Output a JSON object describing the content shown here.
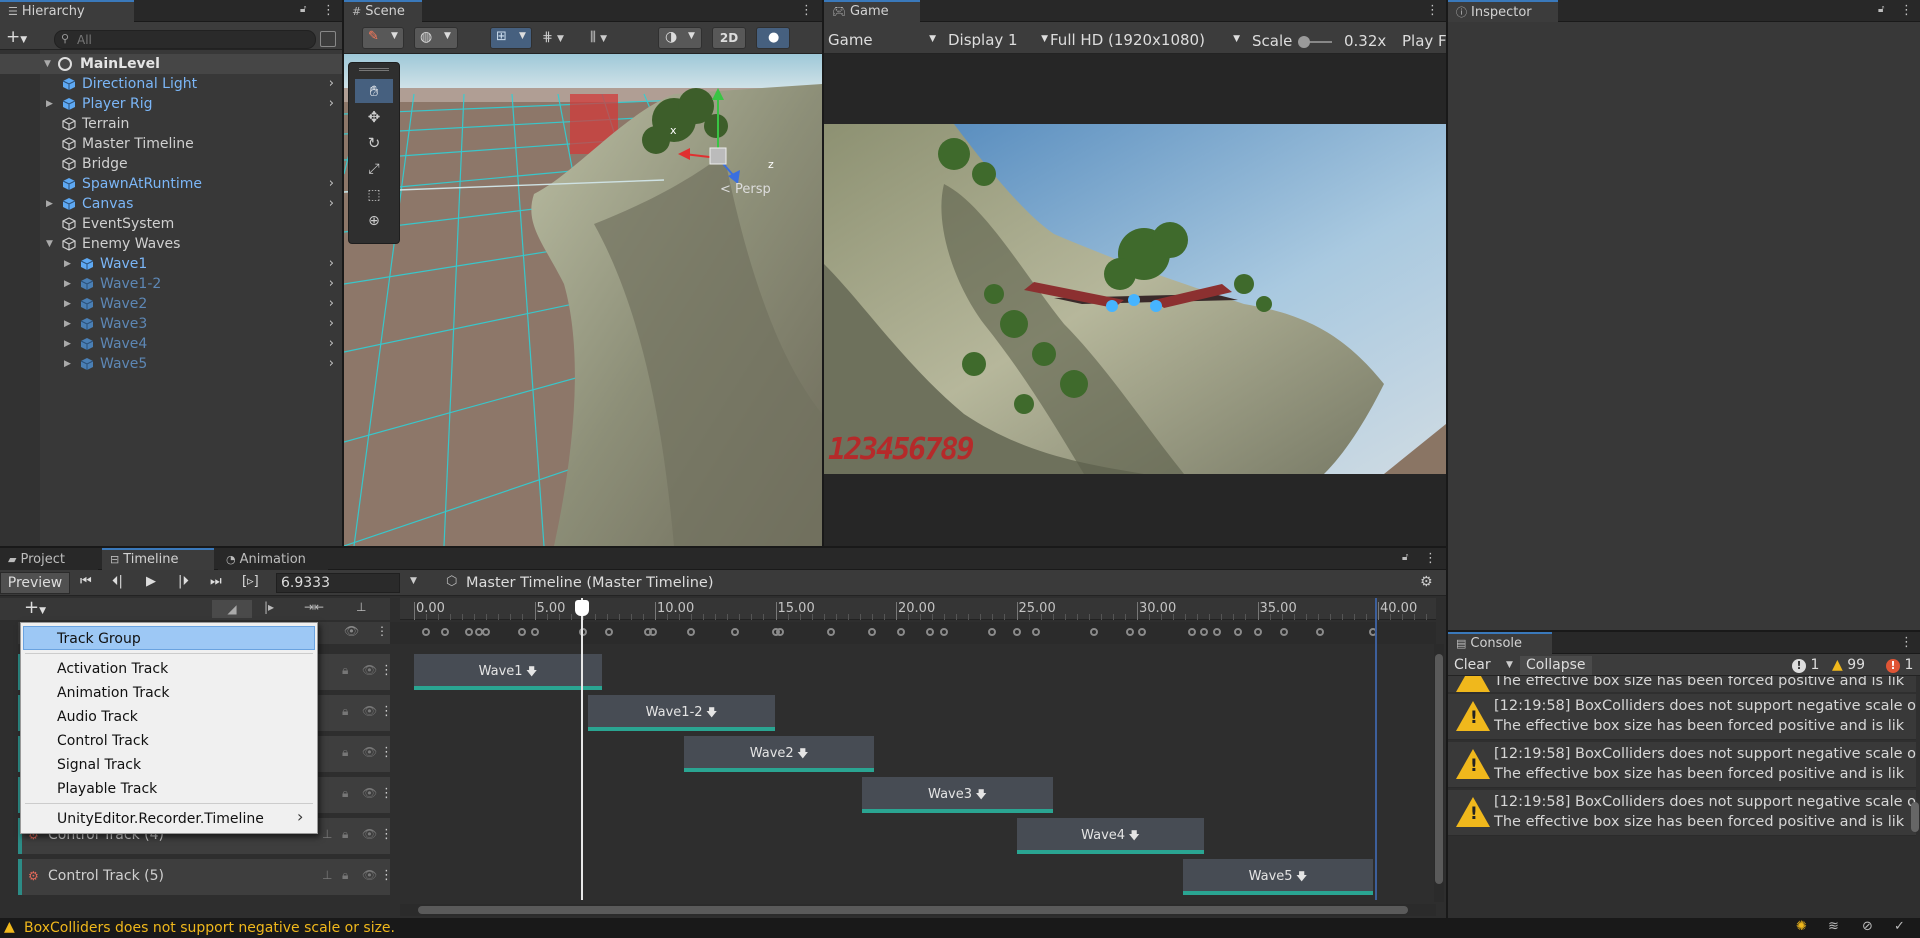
{
  "hierarchy": {
    "tab_label": "Hierarchy",
    "search_placeholder": "All",
    "scene_root": "MainLevel",
    "items": [
      {
        "label": "Directional Light",
        "kind": "prefab",
        "indent": 1,
        "expand": "",
        "chevron": true
      },
      {
        "label": "Player Rig",
        "kind": "prefab",
        "indent": 1,
        "expand": "▶",
        "chevron": true
      },
      {
        "label": "Terrain",
        "kind": "plain",
        "indent": 1,
        "expand": "",
        "chevron": false
      },
      {
        "label": "Master Timeline",
        "kind": "plain",
        "indent": 1,
        "expand": "",
        "chevron": false
      },
      {
        "label": "Bridge",
        "kind": "plain",
        "indent": 1,
        "expand": "",
        "chevron": false
      },
      {
        "label": "SpawnAtRuntime",
        "kind": "prefab",
        "indent": 1,
        "expand": "",
        "chevron": true
      },
      {
        "label": "Canvas",
        "kind": "prefab",
        "indent": 1,
        "expand": "▶",
        "chevron": true
      },
      {
        "label": "EventSystem",
        "kind": "plain",
        "indent": 1,
        "expand": "",
        "chevron": false
      },
      {
        "label": "Enemy Waves",
        "kind": "plain",
        "indent": 1,
        "expand": "▼",
        "chevron": false
      },
      {
        "label": "Wave1",
        "kind": "prefab",
        "indent": 2,
        "expand": "▶",
        "chevron": true
      },
      {
        "label": "Wave1-2",
        "kind": "prefab-dim",
        "indent": 2,
        "expand": "▶",
        "chevron": true
      },
      {
        "label": "Wave2",
        "kind": "prefab-dim",
        "indent": 2,
        "expand": "▶",
        "chevron": true
      },
      {
        "label": "Wave3",
        "kind": "prefab-dim",
        "indent": 2,
        "expand": "▶",
        "chevron": true
      },
      {
        "label": "Wave4",
        "kind": "prefab-dim",
        "indent": 2,
        "expand": "▶",
        "chevron": true
      },
      {
        "label": "Wave5",
        "kind": "prefab-dim",
        "indent": 2,
        "expand": "▶",
        "chevron": true
      }
    ]
  },
  "scene": {
    "tab_label": "Scene",
    "btn_2d": "2D",
    "persp_label": "< Persp",
    "gizmo_x": "x",
    "gizmo_z": "z"
  },
  "game": {
    "tab_label": "Game",
    "view_mode": "Game",
    "display": "Display 1",
    "resolution": "Full HD (1920x1080)",
    "scale_label": "Scale",
    "scale_value": "0.32x",
    "play_label": "Play F",
    "hud_digits": "123456789"
  },
  "inspector": {
    "tab_label": "Inspector"
  },
  "bottom_tabs": {
    "project": "Project",
    "timeline": "Timeline",
    "animation": "Animation"
  },
  "timeline": {
    "preview": "Preview",
    "frame_value": "6.9333",
    "asset_name": "Master Timeline (Master Timeline)",
    "ruler": [
      "0.00",
      "5.00",
      "10.00",
      "15.00",
      "20.00",
      "25.00",
      "30.00",
      "35.00",
      "40.00"
    ],
    "tracks": [
      "Control Track (4)",
      "Control Track (5)"
    ],
    "clips": [
      {
        "label": "Wave1",
        "start": 0.0,
        "end": 7.8
      },
      {
        "label": "Wave1-2",
        "start": 7.2,
        "end": 15.0
      },
      {
        "label": "Wave2",
        "start": 11.2,
        "end": 19.1
      },
      {
        "label": "Wave3",
        "start": 18.6,
        "end": 26.5
      },
      {
        "label": "Wave4",
        "start": 25.0,
        "end": 32.8
      },
      {
        "label": "Wave5",
        "start": 31.9,
        "end": 39.8
      }
    ],
    "playhead": 6.9333
  },
  "add_menu": {
    "items": [
      "Track Group",
      "Activation Track",
      "Animation Track",
      "Audio Track",
      "Control Track",
      "Signal Track",
      "Playable Track",
      "UnityEditor.Recorder.Timeline"
    ],
    "submenu_arrow": "›"
  },
  "console": {
    "tab_label": "Console",
    "clear": "Clear",
    "collapse": "Collapse",
    "count_info": "1",
    "count_warn": "99",
    "count_err": "1",
    "partial_top": "The effective box size has been forced positive and is lik",
    "messages": [
      {
        "line1": "[12:19:58] BoxColliders does not support negative scale o",
        "line2": "The effective box size has been forced positive and is lik"
      },
      {
        "line1": "[12:19:58] BoxColliders does not support negative scale o",
        "line2": "The effective box size has been forced positive and is lik"
      },
      {
        "line1": "[12:19:58] BoxColliders does not support negative scale o",
        "line2": "The effective box size has been forced positive and is lik"
      }
    ]
  },
  "status_bar": {
    "message": "BoxColliders does not support negative scale or size."
  }
}
